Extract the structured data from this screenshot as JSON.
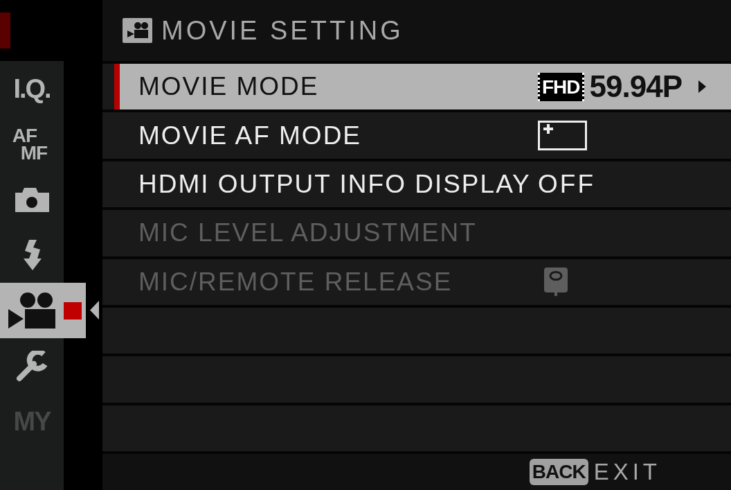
{
  "header": {
    "title": "MOVIE SETTING"
  },
  "sidebar": {
    "items": [
      {
        "kind": "text",
        "label": "I.Q.",
        "selected": false,
        "disabled": false
      },
      {
        "kind": "stacked",
        "label_top": "AF",
        "label_bottom": "MF",
        "selected": false,
        "disabled": false
      },
      {
        "kind": "camera",
        "selected": false,
        "disabled": false
      },
      {
        "kind": "flash",
        "selected": false,
        "disabled": false
      },
      {
        "kind": "movie",
        "selected": true,
        "disabled": false
      },
      {
        "kind": "wrench",
        "selected": false,
        "disabled": false
      },
      {
        "kind": "text",
        "label": "MY",
        "selected": false,
        "disabled": true
      }
    ]
  },
  "menu": {
    "items": [
      {
        "label": "MOVIE MODE",
        "selected": true,
        "disabled": false,
        "value": {
          "kind": "resolution",
          "badge": "FHD",
          "text": "59.94P"
        }
      },
      {
        "label": "MOVIE AF MODE",
        "selected": false,
        "disabled": false,
        "value": {
          "kind": "af_area"
        }
      },
      {
        "label": "HDMI OUTPUT INFO DISPLAY",
        "selected": false,
        "disabled": false,
        "value": {
          "kind": "text",
          "text": "OFF"
        }
      },
      {
        "label": "MIC LEVEL ADJUSTMENT",
        "selected": false,
        "disabled": true
      },
      {
        "label": "MIC/REMOTE RELEASE",
        "selected": false,
        "disabled": true,
        "value": {
          "kind": "mic"
        }
      }
    ]
  },
  "footer": {
    "key": "BACK",
    "label": "EXIT"
  }
}
